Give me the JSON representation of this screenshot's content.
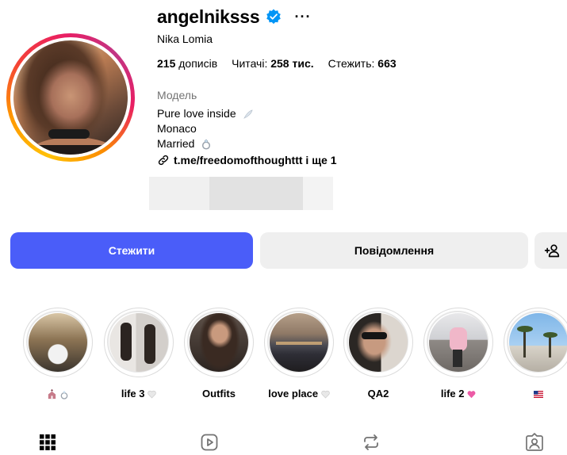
{
  "profile": {
    "username": "angelniksss",
    "full_name": "Nika Lomia",
    "stats": {
      "posts_value": "215",
      "posts_label": "дописів",
      "followers_label": "Читачі:",
      "followers_value": "258 тис.",
      "following_label": "Стежить:",
      "following_value": "663"
    },
    "category": "Модель",
    "bio_lines": [
      "Pure love inside",
      "Monaco",
      "Married"
    ],
    "link": "t.me/freedomofthoughttt і ще 1"
  },
  "actions": {
    "follow_label": "Стежити",
    "message_label": "Повідомлення"
  },
  "highlights": [
    {
      "label": ""
    },
    {
      "label": "life 3"
    },
    {
      "label": "Outfits"
    },
    {
      "label": "love place"
    },
    {
      "label": "QA2"
    },
    {
      "label": "life 2"
    },
    {
      "label": ""
    }
  ],
  "tabs": [
    {
      "icon": "grid-icon"
    },
    {
      "icon": "reels-icon"
    },
    {
      "icon": "reposts-icon"
    },
    {
      "icon": "tagged-icon"
    }
  ],
  "colors": {
    "accent": "#4a5df9",
    "verified": "#0095f6",
    "secondary_text": "#737373",
    "button_gray": "#efefef"
  }
}
